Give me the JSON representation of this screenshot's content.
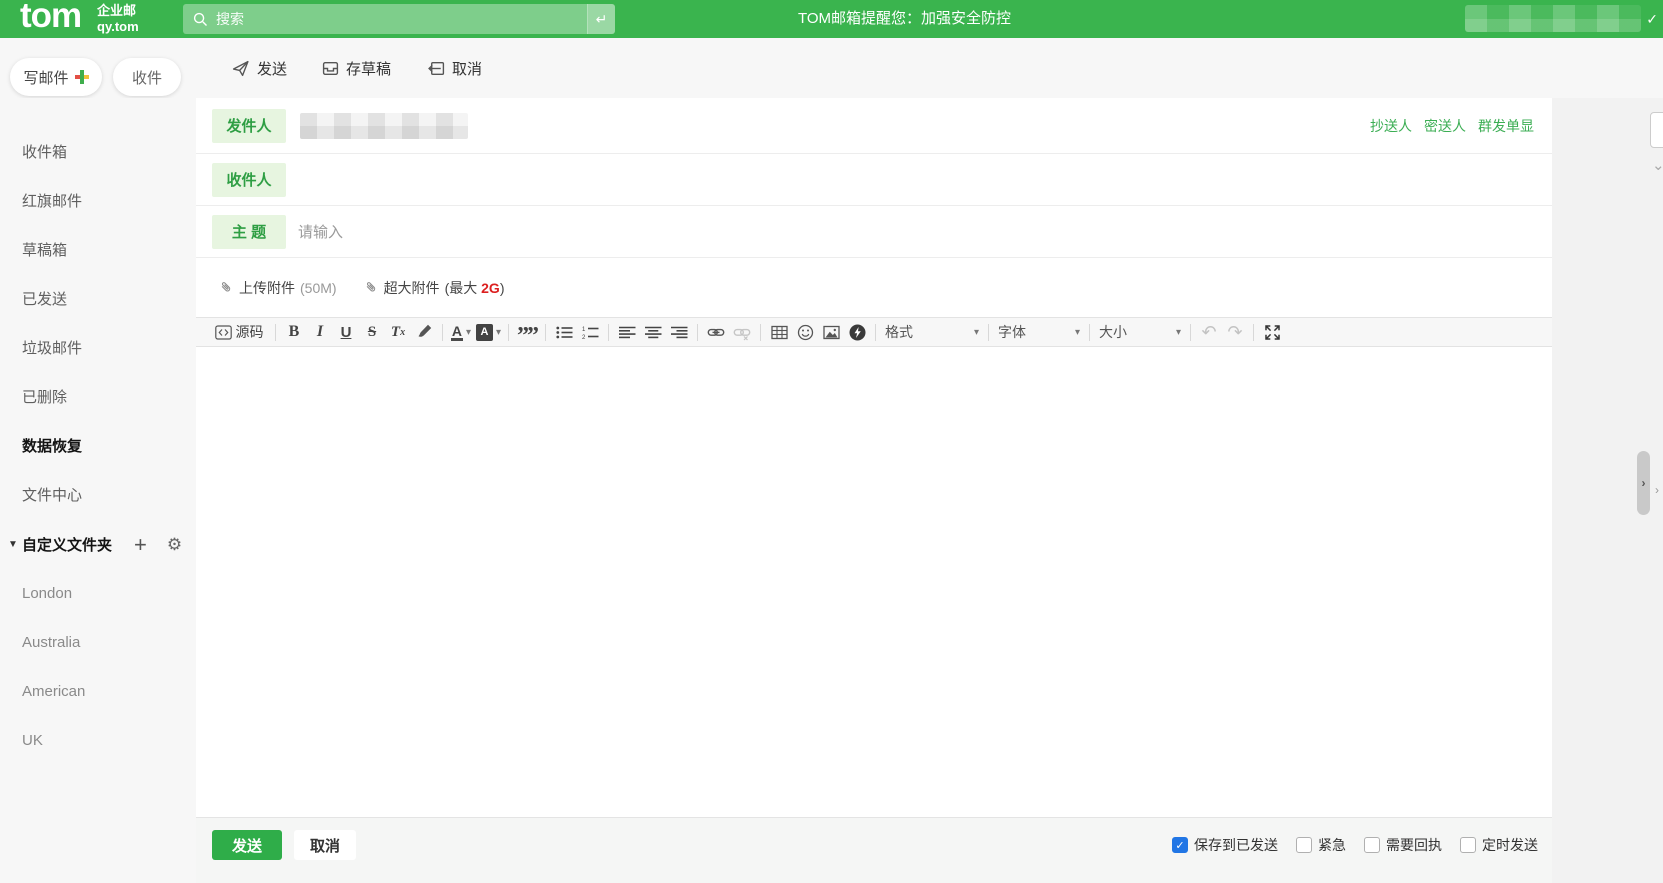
{
  "topbar": {
    "logo": "tom",
    "brand_top": "企业邮",
    "brand_bottom": "qy.tom",
    "search_placeholder": "搜索",
    "notice": "TOM邮箱提醒您：加强安全防控"
  },
  "sidebar": {
    "compose": "写邮件",
    "inbox_btn": "收件",
    "items": [
      {
        "label": "收件箱",
        "active": false
      },
      {
        "label": "红旗邮件",
        "active": false
      },
      {
        "label": "草稿箱",
        "active": false
      },
      {
        "label": "已发送",
        "active": false
      },
      {
        "label": "垃圾邮件",
        "active": false
      },
      {
        "label": "已删除",
        "active": false
      },
      {
        "label": "数据恢复",
        "active": true
      },
      {
        "label": "文件中心",
        "active": false
      }
    ],
    "custom_folder_label": "自定义文件夹",
    "folders": [
      {
        "label": "London"
      },
      {
        "label": "Australia"
      },
      {
        "label": "American"
      },
      {
        "label": "UK"
      }
    ]
  },
  "actions": {
    "send": "发送",
    "save_draft": "存草稿",
    "cancel": "取消"
  },
  "compose": {
    "from_label": "发件人",
    "to_label": "收件人",
    "subject_label": "主 题",
    "subject_placeholder": "请输入",
    "cc_link": "抄送人",
    "bcc_link": "密送人",
    "mass_link": "群发单显",
    "attach_label": "上传附件",
    "attach_limit": "(50M)",
    "big_attach_label": "超大附件",
    "big_attach_prefix": "(最大 ",
    "big_attach_size": "2G",
    "big_attach_suffix": ")"
  },
  "editor": {
    "source": "源码",
    "bold": "B",
    "italic": "I",
    "underline": "U",
    "strike": "S",
    "remove_t": "T",
    "remove_x": "x",
    "color_letter": "A",
    "bgcolor_letter": "A",
    "format": "格式",
    "font": "字体",
    "size": "大小"
  },
  "footer": {
    "send": "发送",
    "cancel": "取消",
    "checkboxes": [
      {
        "label": "保存到已发送",
        "checked": true
      },
      {
        "label": "紧急",
        "checked": false
      },
      {
        "label": "需要回执",
        "checked": false
      },
      {
        "label": "定时发送",
        "checked": false
      }
    ]
  },
  "icons": {
    "quote": "””",
    "gear": "⚙",
    "plus": "+",
    "triangle_down": "▼",
    "dropdown": "▾",
    "check": "✓",
    "enter": "↵",
    "undo": "↶",
    "redo": "↷",
    "chevron_down": "⌄",
    "panel_handle": "›",
    "panel_handle_small": "›"
  },
  "colors": {
    "brand_green": "#3ab44e",
    "accent_green": "#2fad49",
    "link_green": "#3cae54",
    "label_bg_green": "#e7f5e0",
    "checkbox_blue": "#2176e5",
    "danger_red": "#dc2020"
  }
}
